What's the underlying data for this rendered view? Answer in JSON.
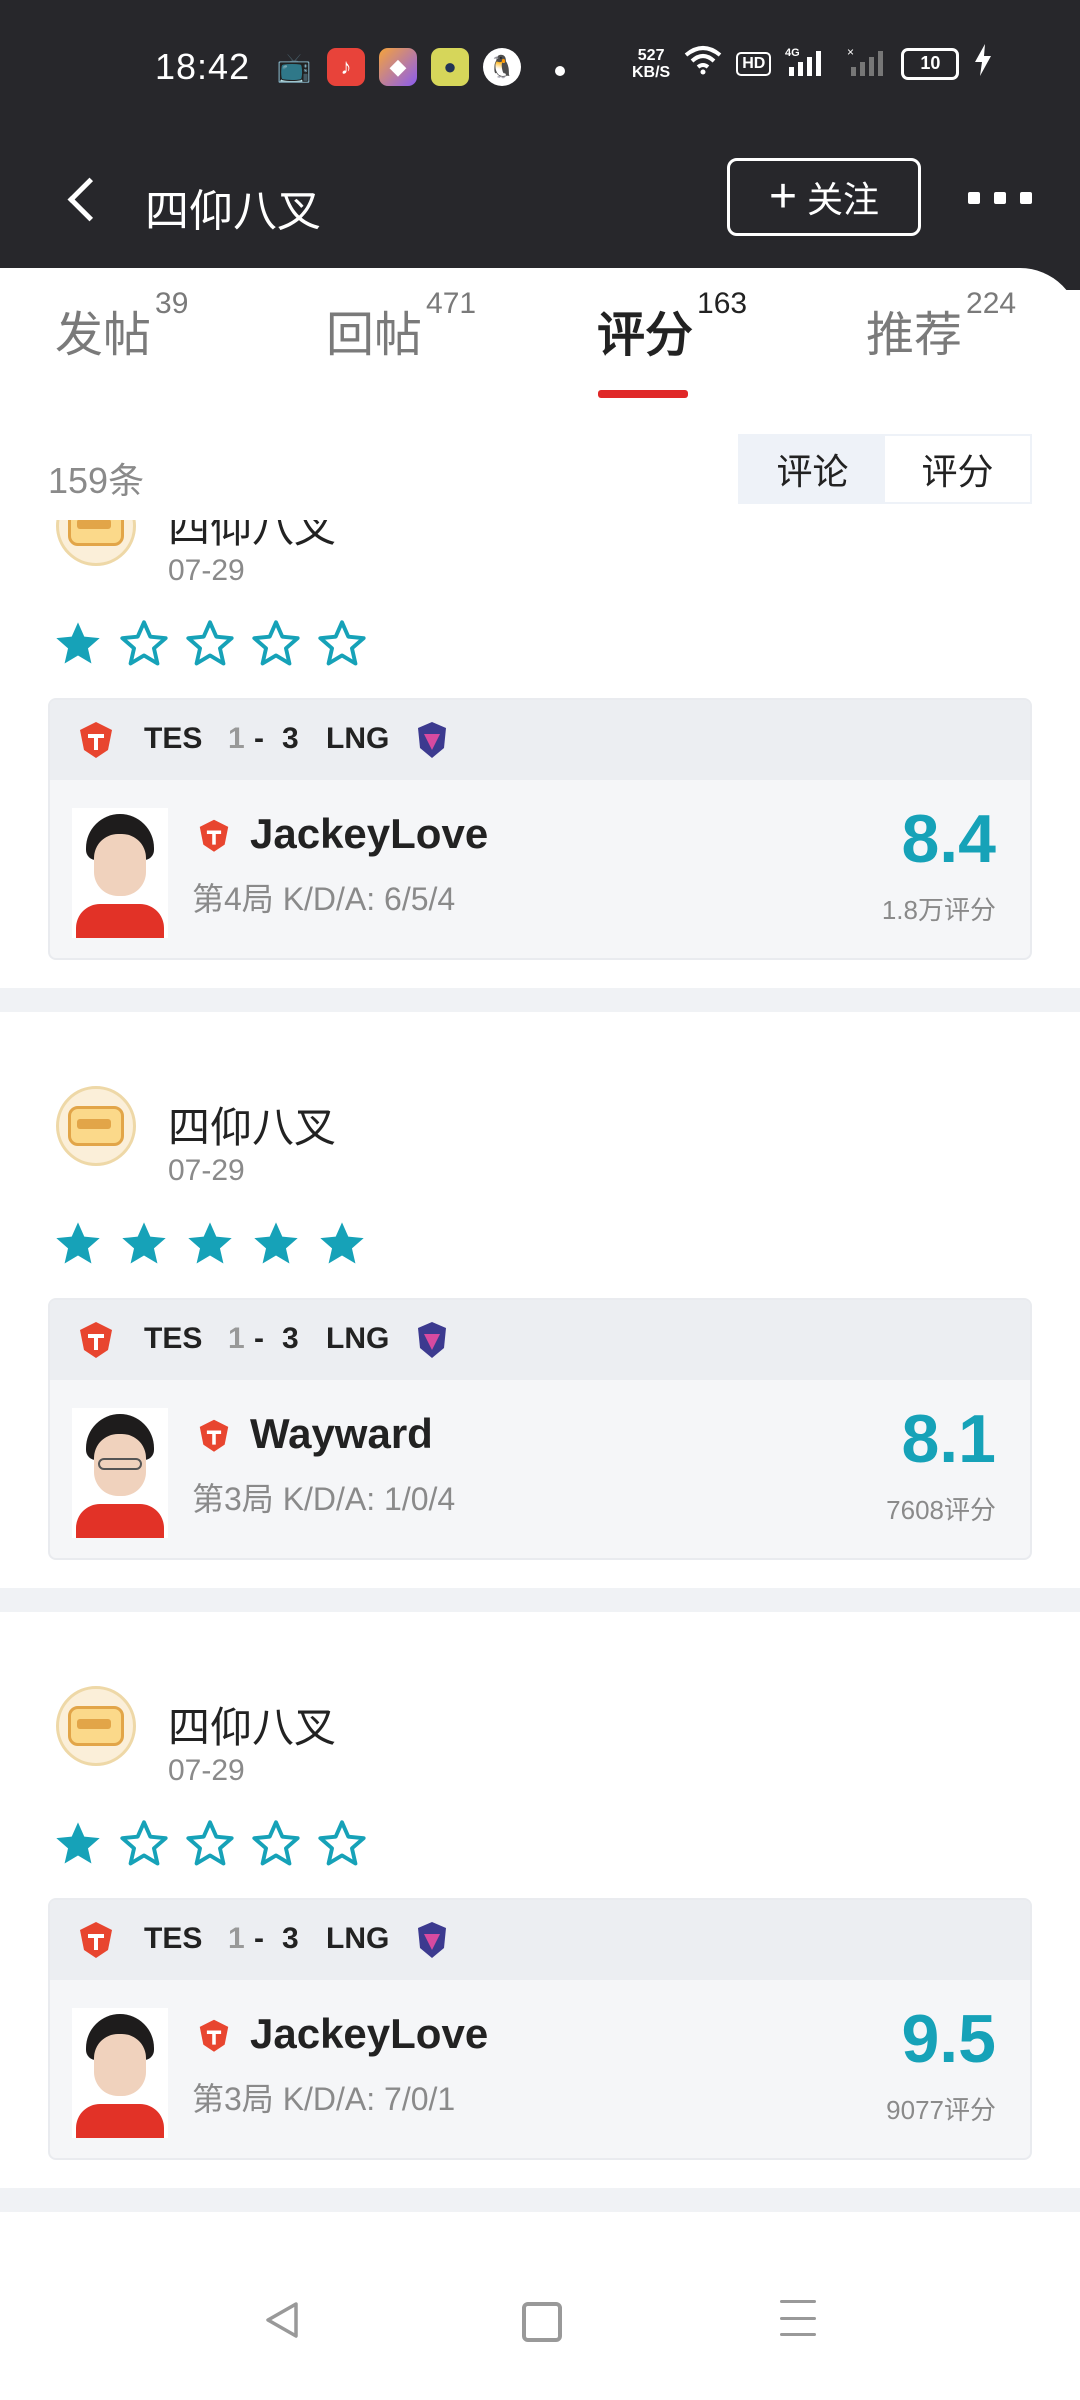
{
  "status_bar": {
    "time": "18:42",
    "net_speed_value": "527",
    "net_speed_unit": "KB/S",
    "network": "4G",
    "hd_label": "HD",
    "battery": "10"
  },
  "header": {
    "title": "四仰八叉",
    "follow_label": "关注"
  },
  "tabs": [
    {
      "label": "发帖",
      "count": "39"
    },
    {
      "label": "回帖",
      "count": "471"
    },
    {
      "label": "评分",
      "count": "163"
    },
    {
      "label": "推荐",
      "count": "224"
    }
  ],
  "active_tab": "评分",
  "subbar": {
    "total": "159条",
    "toggle": [
      "评论",
      "评分"
    ],
    "selected_toggle": "评分"
  },
  "colors": {
    "accent_red": "#e02828",
    "score_teal": "#16a2b8",
    "star_teal": "#16a2b8"
  },
  "ratings": [
    {
      "username": "四仰八叉",
      "date": "07-29",
      "stars": 1,
      "match": {
        "team_a": "TES",
        "score_a": "1",
        "sep": "-",
        "score_b": "3",
        "team_b": "LNG"
      },
      "player": "JackeyLove",
      "kda": "第4局 K/D/A: 6/5/4",
      "score": "8.4",
      "votes": "1.8万评分",
      "glasses": false
    },
    {
      "username": "四仰八叉",
      "date": "07-29",
      "stars": 5,
      "match": {
        "team_a": "TES",
        "score_a": "1",
        "sep": "-",
        "score_b": "3",
        "team_b": "LNG"
      },
      "player": "Wayward",
      "kda": "第3局 K/D/A: 1/0/4",
      "score": "8.1",
      "votes": "7608评分",
      "glasses": true
    },
    {
      "username": "四仰八叉",
      "date": "07-29",
      "stars": 1,
      "match": {
        "team_a": "TES",
        "score_a": "1",
        "sep": "-",
        "score_b": "3",
        "team_b": "LNG"
      },
      "player": "JackeyLove",
      "kda": "第3局 K/D/A: 7/0/1",
      "score": "9.5",
      "votes": "9077评分",
      "glasses": false
    }
  ]
}
